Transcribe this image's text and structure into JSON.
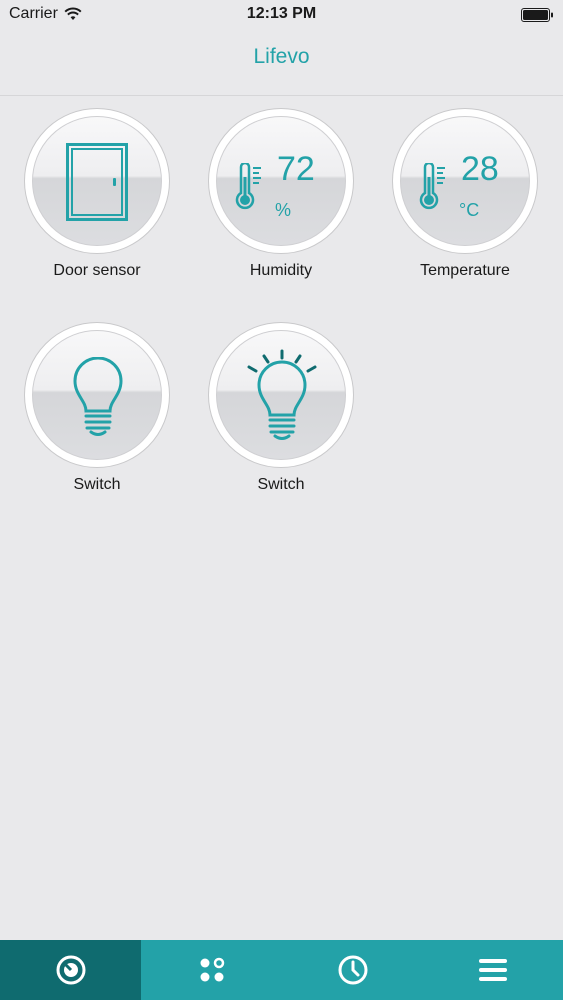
{
  "status_bar": {
    "carrier": "Carrier",
    "time": "12:13 PM"
  },
  "nav": {
    "title": "Lifevo"
  },
  "devices": [
    {
      "label": "Door sensor",
      "icon": "door-icon"
    },
    {
      "label": "Humidity",
      "icon": "thermometer-icon",
      "value": "72",
      "unit": "%"
    },
    {
      "label": "Temperature",
      "icon": "thermometer-icon",
      "value": "28",
      "unit": "°C"
    },
    {
      "label": "Switch",
      "icon": "lightbulb-off-icon"
    },
    {
      "label": "Switch",
      "icon": "lightbulb-on-icon"
    }
  ],
  "tabs": [
    {
      "icon": "home-dial-icon",
      "active": true
    },
    {
      "icon": "scenes-icon",
      "active": false
    },
    {
      "icon": "clock-icon",
      "active": false
    },
    {
      "icon": "menu-icon",
      "active": false
    }
  ],
  "colors": {
    "accent": "#23a2a8",
    "tab_active": "#0f6b6f",
    "background": "#e9e9eb"
  }
}
